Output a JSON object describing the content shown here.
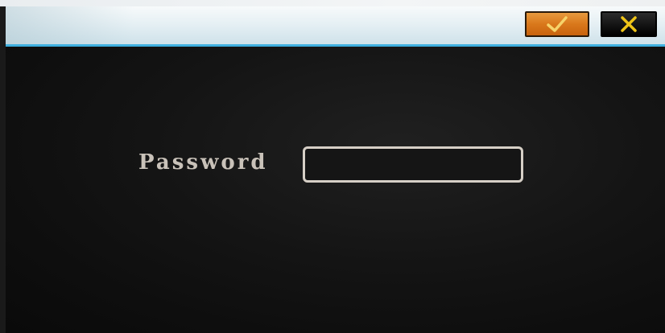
{
  "titlebar": {
    "ok_button": {
      "icon": "checkmark-icon",
      "color": "#d9781b"
    },
    "cancel_button": {
      "icon": "close-icon",
      "color": "#e8c21a"
    },
    "accent_color": "#3fb0e0"
  },
  "form": {
    "password_label": "Password",
    "password_value": ""
  }
}
